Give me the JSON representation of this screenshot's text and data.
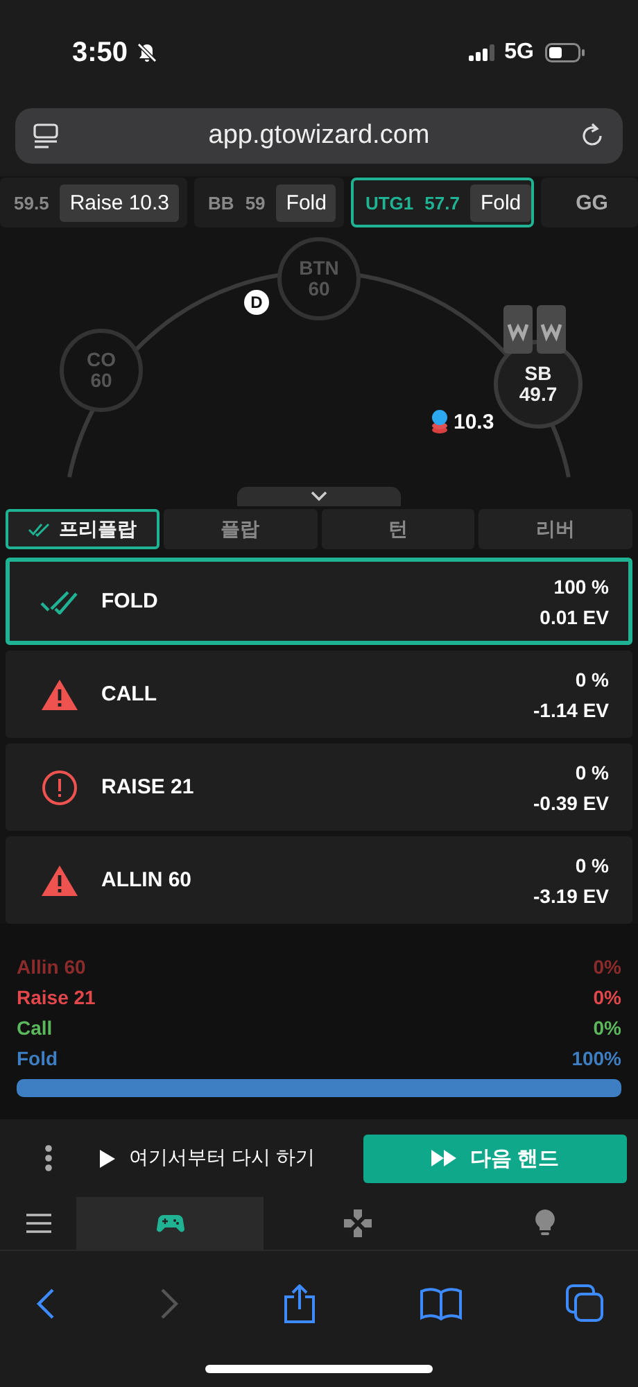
{
  "status_bar": {
    "time": "3:50",
    "network": "5G"
  },
  "address_bar": {
    "url": "app.gtowizard.com"
  },
  "history": [
    {
      "kind": "action",
      "stack": "59.5",
      "action": "Raise 10.3",
      "selected": false
    },
    {
      "kind": "action",
      "position": "BB",
      "stack": "59",
      "action": "Fold",
      "selected": false
    },
    {
      "kind": "action",
      "position": "UTG1",
      "stack": "57.7",
      "action": "Fold",
      "selected": true
    },
    {
      "kind": "end",
      "label": "GG",
      "selected": false
    }
  ],
  "table": {
    "seats": [
      {
        "position": "BTN",
        "stack": "60",
        "active": false,
        "dealer_button": "D"
      },
      {
        "position": "CO",
        "stack": "60",
        "active": false
      },
      {
        "position": "SB",
        "stack": "49.7",
        "active": true,
        "cards": true
      }
    ],
    "bet": "10.3"
  },
  "street_tabs": [
    {
      "label": "프리플랍",
      "selected": true
    },
    {
      "label": "플랍",
      "selected": false
    },
    {
      "label": "턴",
      "selected": false
    },
    {
      "label": "리버",
      "selected": false
    }
  ],
  "actions": [
    {
      "kind": "best",
      "label": "FOLD",
      "frequency": "100 %",
      "ev": "0.01 EV",
      "selected": true
    },
    {
      "kind": "warning",
      "label": "CALL",
      "frequency": "0 %",
      "ev": "-1.14 EV",
      "selected": false
    },
    {
      "kind": "error",
      "label": "RAISE 21",
      "frequency": "0 %",
      "ev": "-0.39 EV",
      "selected": false
    },
    {
      "kind": "warning",
      "label": "ALLIN 60",
      "frequency": "0 %",
      "ev": "-3.19 EV",
      "selected": false
    }
  ],
  "strategy": [
    {
      "label": "Allin 60",
      "value": "0%",
      "color": "#8c2b2b"
    },
    {
      "label": "Raise 21",
      "value": "0%",
      "color": "#e2474b"
    },
    {
      "label": "Call",
      "value": "0%",
      "color": "#5cb85c"
    },
    {
      "label": "Fold",
      "value": "100%",
      "color": "#3e7ec2"
    }
  ],
  "strategy_bar": {
    "level": 1
  },
  "controls": {
    "replay": "여기서부터 다시 하기",
    "next": "다음 핸드"
  },
  "nav_tabs": [
    {
      "kind": "menu",
      "selected": false
    },
    {
      "kind": "gamepad",
      "selected": true
    },
    {
      "kind": "dpad",
      "selected": false
    },
    {
      "kind": "bulb",
      "selected": false
    }
  ],
  "browser_toolbar": {
    "forward_disabled": true
  }
}
